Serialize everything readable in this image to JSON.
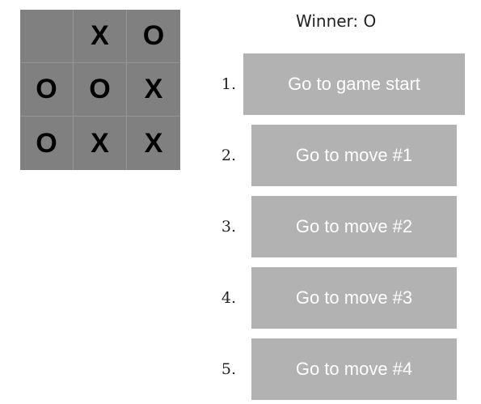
{
  "status": {
    "text": "Winner: O"
  },
  "board": {
    "cells": [
      "",
      "X",
      "O",
      "O",
      "O",
      "X",
      "O",
      "X",
      "X"
    ]
  },
  "moves": [
    {
      "number": "1.",
      "label": "Go to game start"
    },
    {
      "number": "2.",
      "label": "Go to move #1"
    },
    {
      "number": "3.",
      "label": "Go to move #2"
    },
    {
      "number": "4.",
      "label": "Go to move #3"
    },
    {
      "number": "5.",
      "label": "Go to move #4"
    }
  ],
  "colors": {
    "square": "#808080",
    "square_border": "#959595",
    "move_button": "#b2b2b2",
    "move_button_text": "#ffffff"
  }
}
